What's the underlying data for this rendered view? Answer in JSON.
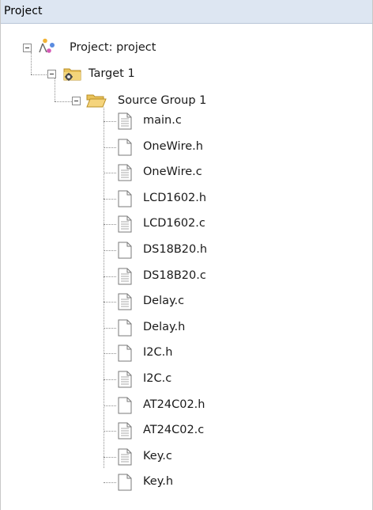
{
  "panel": {
    "title": "Project"
  },
  "tree": {
    "project": {
      "label": "Project: project",
      "icon": "project-icon"
    },
    "target": {
      "label": "Target 1",
      "icon": "target-folder-icon"
    },
    "group": {
      "label": "Source Group 1",
      "icon": "folder-open-icon"
    },
    "files": [
      {
        "label": "main.c",
        "icon": "c-source-file-icon"
      },
      {
        "label": "OneWire.h",
        "icon": "header-file-icon"
      },
      {
        "label": "OneWire.c",
        "icon": "c-source-file-icon"
      },
      {
        "label": "LCD1602.h",
        "icon": "header-file-icon"
      },
      {
        "label": "LCD1602.c",
        "icon": "c-source-file-icon"
      },
      {
        "label": "DS18B20.h",
        "icon": "header-file-icon"
      },
      {
        "label": "DS18B20.c",
        "icon": "c-source-file-icon"
      },
      {
        "label": "Delay.c",
        "icon": "c-source-file-icon"
      },
      {
        "label": "Delay.h",
        "icon": "header-file-icon"
      },
      {
        "label": "I2C.h",
        "icon": "header-file-icon"
      },
      {
        "label": "I2C.c",
        "icon": "c-source-file-icon"
      },
      {
        "label": "AT24C02.h",
        "icon": "header-file-icon"
      },
      {
        "label": "AT24C02.c",
        "icon": "c-source-file-icon"
      },
      {
        "label": "Key.c",
        "icon": "c-source-file-icon"
      },
      {
        "label": "Key.h",
        "icon": "header-file-icon"
      }
    ]
  }
}
